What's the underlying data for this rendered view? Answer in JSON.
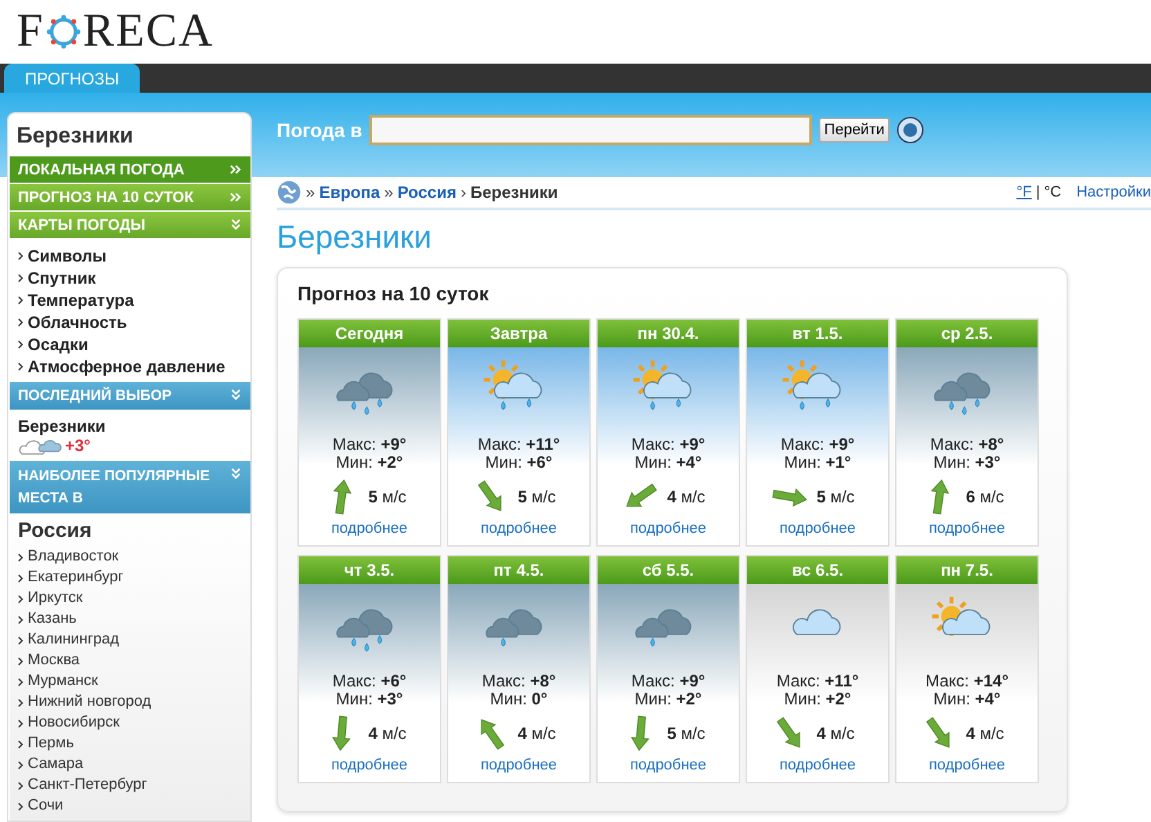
{
  "logo": {
    "before": "F",
    "after": "RECA"
  },
  "nav_tabs": [
    {
      "label": "ПРОГНОЗЫ",
      "selected": true
    }
  ],
  "sidebar": {
    "title": "Березники",
    "menu": [
      {
        "label": "ЛОКАЛЬНАЯ ПОГОДА",
        "kind": "link",
        "selected": true
      },
      {
        "label": "ПРОГНОЗ НА 10 СУТОК",
        "kind": "link",
        "selected": false
      },
      {
        "label": "КАРТЫ ПОГОДЫ",
        "kind": "dropdown",
        "selected": false
      }
    ],
    "map_links": [
      "Символы",
      "Спутник",
      "Температура",
      "Облачность",
      "Осадки",
      "Атмосферное давление"
    ],
    "recent": {
      "header": "ПОСЛЕДНИЙ ВЫБОР",
      "city": "Березники",
      "temp": "+3°"
    },
    "popular": {
      "header": "НАИБОЛЕЕ ПОПУЛЯРНЫЕ МЕСТА В",
      "country": "Россия",
      "cities": [
        "Владивосток",
        "Екатеринбург",
        "Иркутск",
        "Казань",
        "Калининград",
        "Москва",
        "Мурманск",
        "Нижний новгород",
        "Новосибирск",
        "Пермь",
        "Самара",
        "Санкт-Петербург",
        "Сочи"
      ]
    }
  },
  "search": {
    "label": "Погода в",
    "button": "Перейти"
  },
  "breadcrumb": [
    {
      "sep": "»",
      "label": "Европа",
      "link": true
    },
    {
      "sep": "»",
      "label": "Россия",
      "link": true
    },
    {
      "sep": "›",
      "label": "Березники",
      "link": false
    }
  ],
  "units": {
    "fahrenheit": "°F",
    "divider": "|",
    "celsius": "°C",
    "settings": "Настройки"
  },
  "page_title": "Березники",
  "forecast": {
    "title": "Прогноз на 10 суток",
    "days": [
      {
        "day": "Сегодня",
        "kind": "rain",
        "max": "Макс: **+9°**",
        "min": "Мин: **+2°**",
        "wind": {
          "speed": "**5** м/с",
          "kind": "up"
        },
        "more": "подробнее"
      },
      {
        "day": "Завтра",
        "kind": "sun-rain",
        "max": "Макс: **+11°**",
        "min": "Мин: **+6°**",
        "wind": {
          "speed": "**5** м/с",
          "kind": "down-right"
        },
        "more": "подробнее"
      },
      {
        "day": "пн 30.4.",
        "kind": "sun-rain",
        "max": "Макс: **+9°**",
        "min": "Мин: **+4°**",
        "wind": {
          "speed": "**4** м/с",
          "kind": "down-left"
        },
        "more": "подробнее"
      },
      {
        "day": "вт 1.5.",
        "kind": "sun-rain",
        "max": "Макс: **+9°**",
        "min": "Мин: **+1°**",
        "wind": {
          "speed": "**5** м/с",
          "kind": "right"
        },
        "more": "подробнее"
      },
      {
        "day": "ср 2.5.",
        "kind": "rain",
        "max": "Макс: **+8°**",
        "min": "Мин: **+3°**",
        "wind": {
          "speed": "**6** м/с",
          "kind": "up"
        },
        "more": "подробнее"
      },
      {
        "day": "чт 3.5.",
        "kind": "rain",
        "max": "Макс: **+6°**",
        "min": "Мин: **+3°**",
        "wind": {
          "speed": "**4** м/с",
          "kind": "down"
        },
        "more": "подробнее"
      },
      {
        "day": "пт 4.5.",
        "kind": "showers",
        "max": "Макс: **+8°**",
        "min": "Мин: **0°**",
        "wind": {
          "speed": "**4** м/с",
          "kind": "up-left"
        },
        "more": "подробнее"
      },
      {
        "day": "сб 5.5.",
        "kind": "showers",
        "max": "Макс: **+9°**",
        "min": "Мин: **+2°**",
        "wind": {
          "speed": "**5** м/с",
          "kind": "down"
        },
        "more": "подробнее"
      },
      {
        "day": "вс 6.5.",
        "kind": "cloudy",
        "max": "Макс: **+11°**",
        "min": "Мин: **+2°**",
        "wind": {
          "speed": "**4** м/с",
          "kind": "down-right"
        },
        "more": "подробнее"
      },
      {
        "day": "пн 7.5.",
        "kind": "partly-cloudy",
        "max": "Макс: **+14°**",
        "min": "Мин: **+4°**",
        "wind": {
          "speed": "**4** м/с",
          "kind": "down-right"
        },
        "more": "подробнее"
      }
    ]
  }
}
